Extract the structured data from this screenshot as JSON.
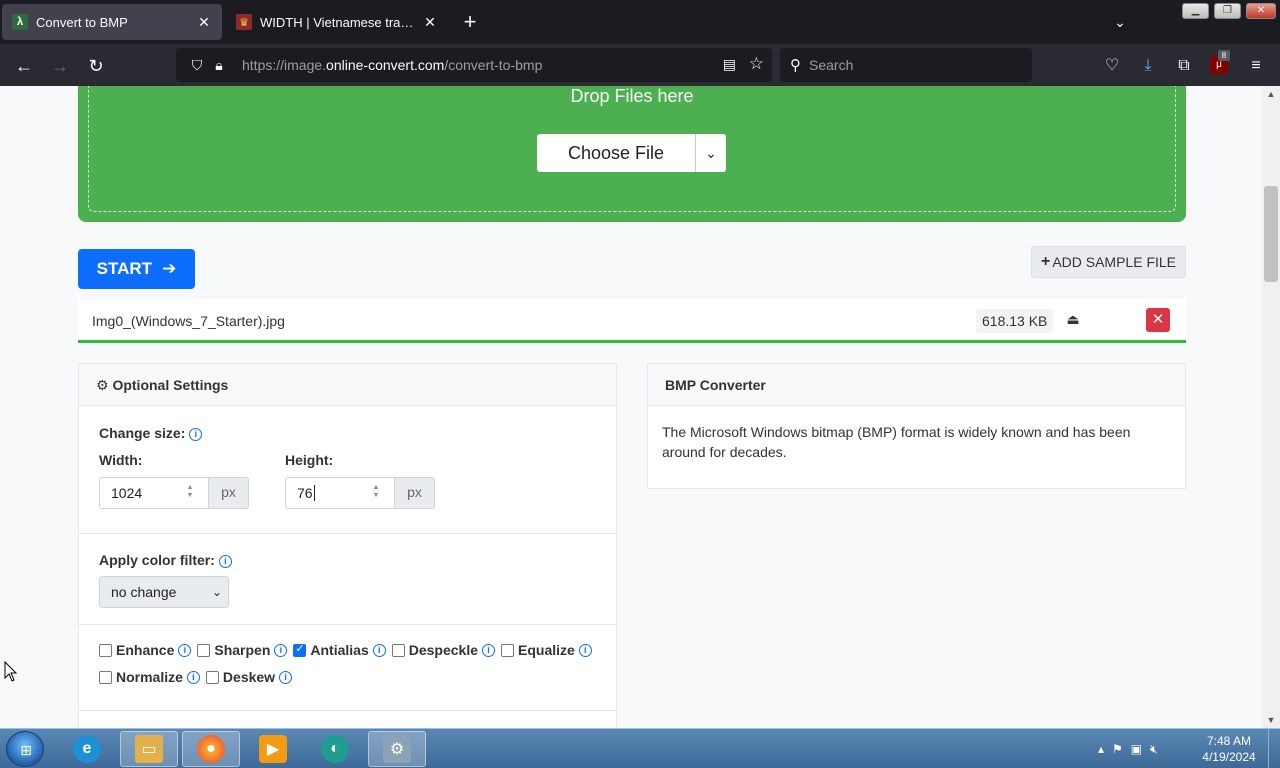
{
  "browser": {
    "tabs": [
      {
        "title": "Convert to BMP",
        "favicon": "online-convert-favicon",
        "active": true
      },
      {
        "title": "WIDTH | Vietnamese translation",
        "favicon": "cambridge-favicon",
        "active": false
      }
    ],
    "url": {
      "scheme": "https://image.",
      "host": "online-convert.com",
      "path": "/convert-to-bmp"
    },
    "search_placeholder": "Search",
    "extension_badge": "8"
  },
  "page": {
    "drop_text": "Drop Files here",
    "choose_file": "Choose File",
    "start_label": "START",
    "add_sample_label": "ADD SAMPLE FILE",
    "file": {
      "name": "Img0_(Windows_7_Starter).jpg",
      "size": "618.13 KB"
    },
    "settings": {
      "title": "Optional Settings",
      "change_size_label": "Change size:",
      "width_label": "Width:",
      "width_value": "1024",
      "height_label": "Height:",
      "height_value": "76",
      "unit": "px",
      "color_filter_label": "Apply color filter:",
      "color_filter_value": "no change",
      "checkboxes": [
        {
          "label": "Enhance",
          "checked": false
        },
        {
          "label": "Sharpen",
          "checked": false
        },
        {
          "label": "Antialias",
          "checked": true
        },
        {
          "label": "Despeckle",
          "checked": false
        },
        {
          "label": "Equalize",
          "checked": false
        },
        {
          "label": "Normalize",
          "checked": false
        },
        {
          "label": "Deskew",
          "checked": false
        }
      ]
    },
    "info_card": {
      "title": "BMP Converter",
      "text": "The Microsoft Windows bitmap (BMP) format is widely known and has been around for decades."
    }
  },
  "taskbar": {
    "apps": [
      "internet-explorer",
      "file-explorer",
      "firefox",
      "media-player",
      "edge-beta",
      "control-panel"
    ],
    "time": "7:48 AM",
    "date": "4/19/2024"
  },
  "colors": {
    "dropzone": "#4caf50",
    "start_button": "#0d6efd",
    "remove_button": "#dc3545",
    "progress": "#28c040"
  }
}
